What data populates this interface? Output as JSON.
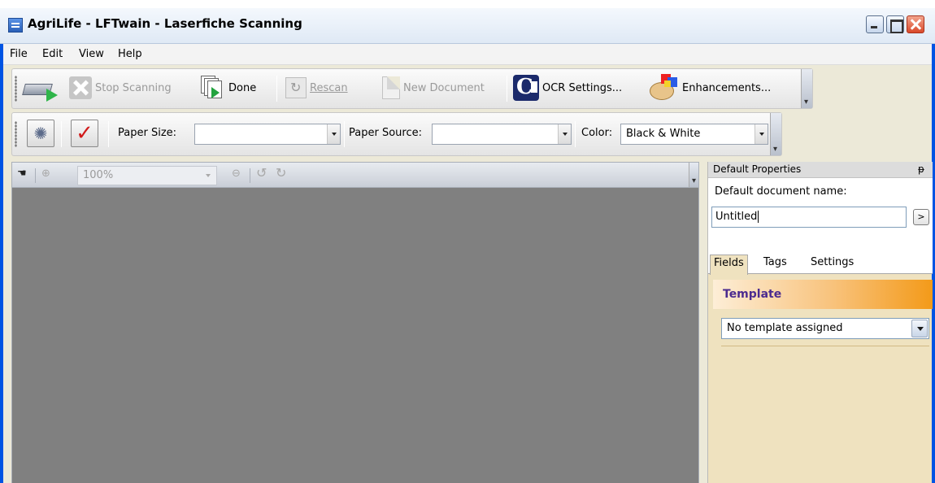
{
  "window": {
    "title": "AgriLife - LFTwain - Laserfiche Scanning"
  },
  "menu": {
    "items": [
      "File",
      "Edit",
      "View",
      "Help"
    ]
  },
  "toolbar_main": {
    "stop_scanning": "Stop Scanning",
    "done": "Done",
    "rescan": "Rescan",
    "new_document": "New Document",
    "ocr_settings": "OCR Settings...",
    "enhancements": "Enhancements..."
  },
  "toolbar_settings": {
    "paper_size_label": "Paper Size:",
    "paper_size_value": "",
    "paper_source_label": "Paper Source:",
    "paper_source_value": "",
    "color_label": "Color:",
    "color_value": "Black & White"
  },
  "viewer": {
    "zoom_value": "100%",
    "background_color": "#808080"
  },
  "properties": {
    "header": "Default Properties",
    "pin_glyph": "ᵽ",
    "doc_name_label": "Default document name:",
    "doc_name_value": "Untitled",
    "go_button": ">",
    "tabs": [
      "Fields",
      "Tags",
      "Settings"
    ],
    "active_tab": "Fields",
    "template_title": "Template",
    "template_value": "No template assigned"
  },
  "colors": {
    "titlebar_border": "#0054e3",
    "panel_bg": "#efe2bf",
    "template_accent": "#f39a19",
    "template_title": "#4b2b8f"
  }
}
